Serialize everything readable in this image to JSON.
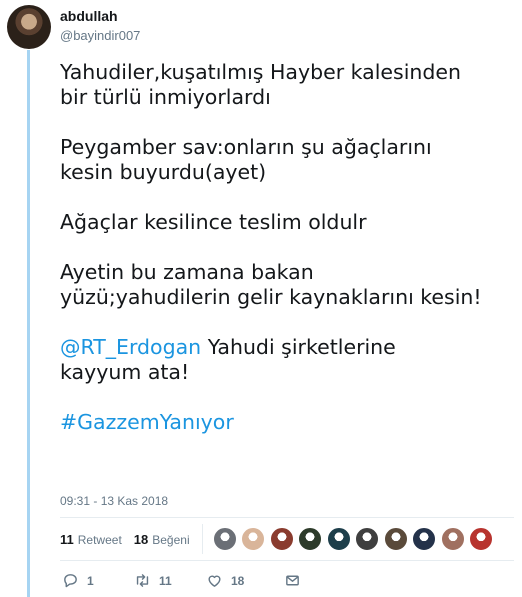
{
  "user": {
    "name": "abdullah",
    "handle": "@bayindir007"
  },
  "tweet": {
    "paragraphs": [
      [
        "Yahudiler,kuşatılmış Hayber kalesinden",
        "bir türlü inmiyorlardı"
      ],
      [
        "Peygamber sav:onların şu ağaçlarını",
        "kesin buyurdu(ayet)"
      ],
      [
        "Ağaçlar kesilince teslim oldulr"
      ],
      [
        "Ayetin bu zamana bakan",
        "yüzü;yahudilerin gelir kaynaklarını kesin!"
      ]
    ],
    "mention": "@RT_Erdogan",
    "mention_rest_line1": " Yahudi şirketlerine",
    "mention_line2": "kayyum ata!",
    "hashtag": "#GazzemYanıyor"
  },
  "timestamp": "09:31 - 13 Kas 2018",
  "stats": {
    "retweets_count": "11",
    "retweets_label": "Retweet",
    "likes_count": "18",
    "likes_label": "Beğeni"
  },
  "liker_colors": [
    "#6b6f76",
    "#d9b59a",
    "#8a3b2e",
    "#2d3b2a",
    "#1d3e4a",
    "#3f3f3f",
    "#5a4a3a",
    "#24324a",
    "#a07060",
    "#b8332e"
  ],
  "actions": {
    "reply_count": "1",
    "retweet_count": "11",
    "like_count": "18"
  },
  "colors": {
    "link": "#1b95e0",
    "thread_line": "#a6d4f2",
    "muted": "#657786"
  }
}
